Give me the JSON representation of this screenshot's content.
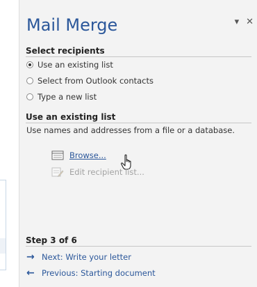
{
  "pane": {
    "title": "Mail Merge",
    "controls": {
      "menu_icon": "dropdown-arrow",
      "close_icon": "close-x"
    },
    "sections": {
      "select_recipients": {
        "heading": "Select recipients",
        "options": [
          {
            "label": "Use an existing list",
            "selected": true
          },
          {
            "label": "Select from Outlook contacts",
            "selected": false
          },
          {
            "label": "Type a new list",
            "selected": false
          }
        ]
      },
      "use_existing": {
        "heading": "Use an existing list",
        "description": "Use names and addresses from a file or a database.",
        "browse_label": "Browse...",
        "edit_label": "Edit recipient list..."
      },
      "step": {
        "heading": "Step 3 of 6",
        "next_label": "Next: Write your letter",
        "previous_label": "Previous: Starting document"
      }
    }
  },
  "colors": {
    "accent": "#2b579a",
    "pane_bg": "#f3f3f3",
    "disabled": "#a3a3a3"
  }
}
